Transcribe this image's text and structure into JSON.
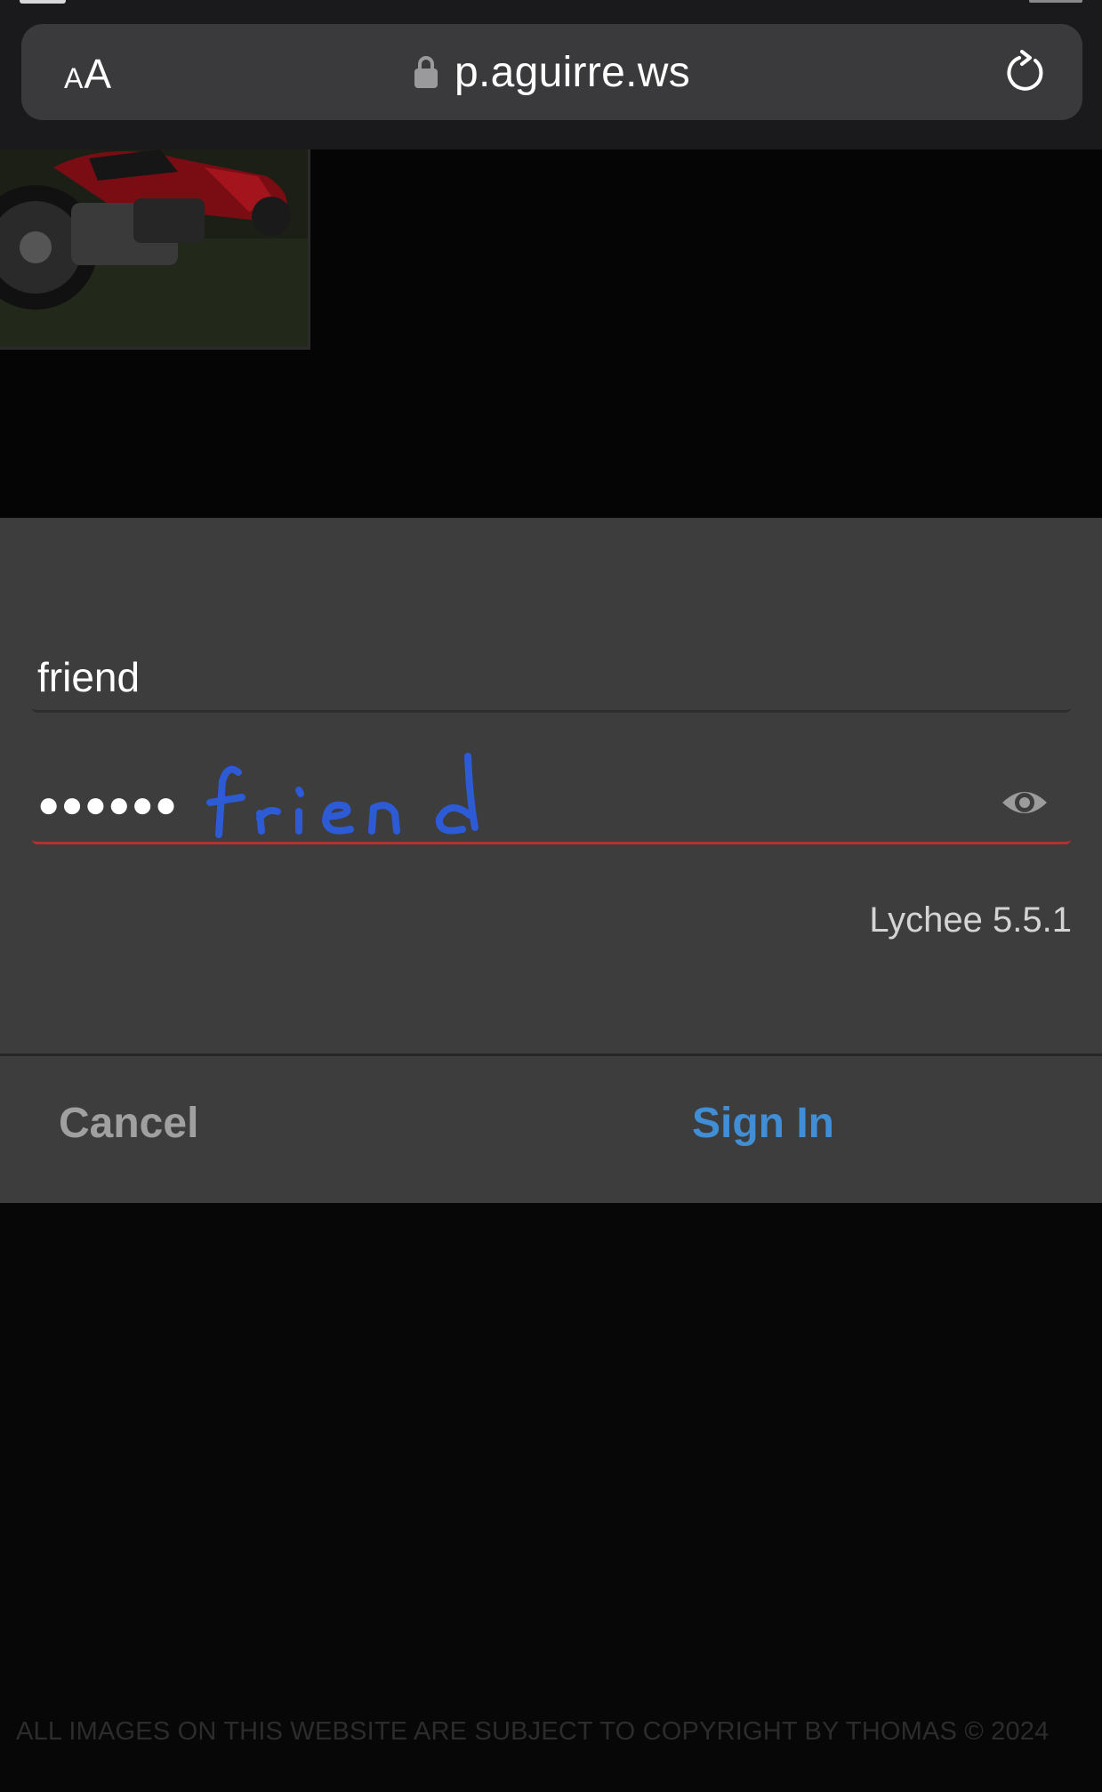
{
  "browser": {
    "text_size_button_small": "A",
    "text_size_button_large": "A",
    "url": "p.aguirre.ws",
    "icons": [
      "lock-icon",
      "reload-icon"
    ]
  },
  "login": {
    "username_value": "friend",
    "password_masked": "●●●●●●",
    "handwritten_annotation": "friend",
    "show_password_icon": "eye-icon",
    "version": "Lychee 5.5.1",
    "error_underline_color": "#b7312f"
  },
  "actions": {
    "cancel_label": "Cancel",
    "signin_label": "Sign In",
    "signin_color": "#3f8ed6"
  },
  "footer": {
    "copyright": "ALL IMAGES ON THIS WEBSITE ARE SUBJECT TO COPYRIGHT BY THOMAS © 2024"
  }
}
